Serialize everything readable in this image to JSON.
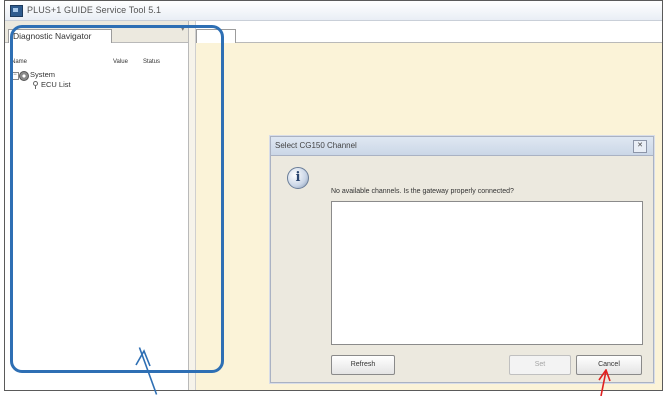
{
  "window": {
    "title": "PLUS+1 GUIDE Service Tool 5.1"
  },
  "left_panel": {
    "tab_label": "Diagnostic Navigator",
    "columns": [
      "Name",
      "Value",
      "Status"
    ],
    "tree": [
      {
        "label": "System",
        "expanded": true,
        "icon": "system-icon"
      },
      {
        "label": "ECU List",
        "icon": "ecu-icon"
      }
    ]
  },
  "dialog": {
    "title": "Select CG150 Channel",
    "message": "No available channels. Is the gateway properly connected?",
    "buttons": {
      "refresh": "Refresh",
      "set": "Set",
      "cancel": "Cancel"
    },
    "close_glyph": "✕",
    "info_glyph": "i"
  },
  "colors": {
    "workspace": "#fbf3d8",
    "annotation_box": "#2e6fb4",
    "annotation_arrow_blue": "#2e6fb4",
    "annotation_arrow_red": "#e02020"
  }
}
